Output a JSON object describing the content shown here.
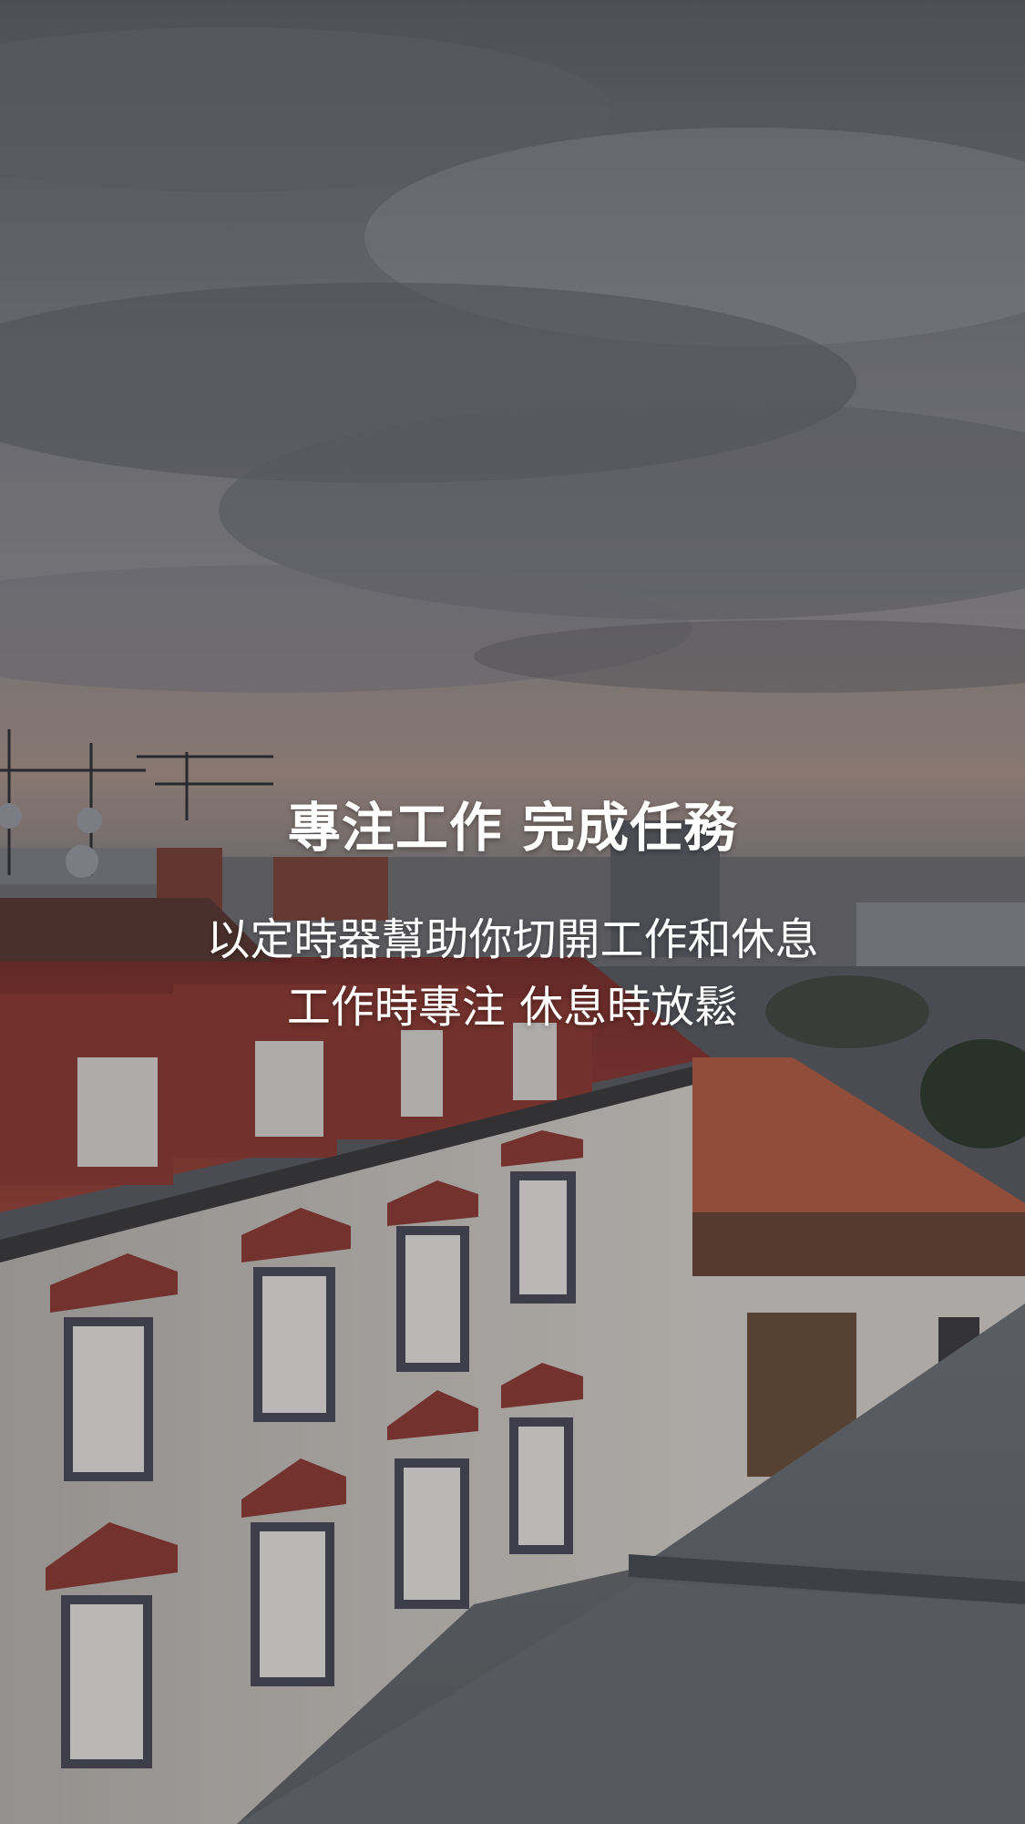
{
  "onboarding": {
    "title": "專注工作 完成任務",
    "description_line1": "以定時器幫助你切開工作和休息",
    "description_line2": "工作時專注 休息時放鬆"
  },
  "colors": {
    "sky_top": "#6d6f77",
    "sky_mid": "#8a8b92",
    "horizon": "#a28b7f",
    "roof_red": "#8a3a33",
    "facade": "#c9c6c2",
    "rooftop": "#6f7276",
    "text": "#ffffff"
  }
}
